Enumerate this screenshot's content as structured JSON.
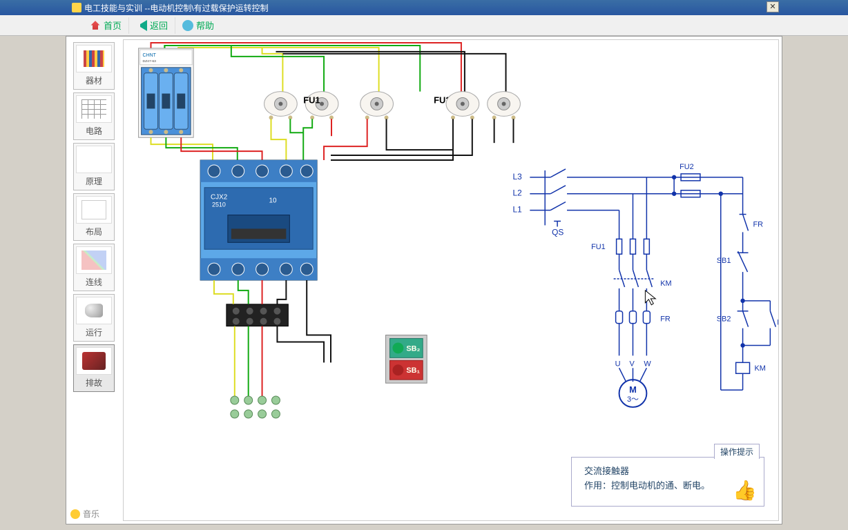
{
  "window": {
    "title": "电工技能与实训 --电动机控制\\有过载保护运转控制"
  },
  "toolbar": {
    "home": "首页",
    "back": "返回",
    "help": "帮助"
  },
  "sidebar": {
    "items": [
      {
        "label": "器材"
      },
      {
        "label": "电路"
      },
      {
        "label": "原理"
      },
      {
        "label": "布局"
      },
      {
        "label": "连线"
      },
      {
        "label": "运行"
      },
      {
        "label": "排故"
      }
    ],
    "music": "音乐"
  },
  "components": {
    "breaker_brand": "CHNT",
    "breaker_model": "DZ47-63",
    "fuse1": "FU1",
    "fuse2": "FU2",
    "contactor_model": "CJX2",
    "contactor_code": "2510",
    "contactor_rating": "10",
    "sb1": "SB₁",
    "sb2": "SB₂"
  },
  "schematic": {
    "l1": "L1",
    "l2": "L2",
    "l3": "L3",
    "qs": "QS",
    "fu1": "FU1",
    "fu2": "FU2",
    "km": "KM",
    "fr": "FR",
    "sb1": "SB1",
    "sb2": "SB2",
    "u": "U",
    "v": "V",
    "w": "W",
    "m": "M",
    "m3": "3～"
  },
  "hint": {
    "tab": "操作提示",
    "title": "交流接触器",
    "body": "作用：控制电动机的通、断电。"
  }
}
